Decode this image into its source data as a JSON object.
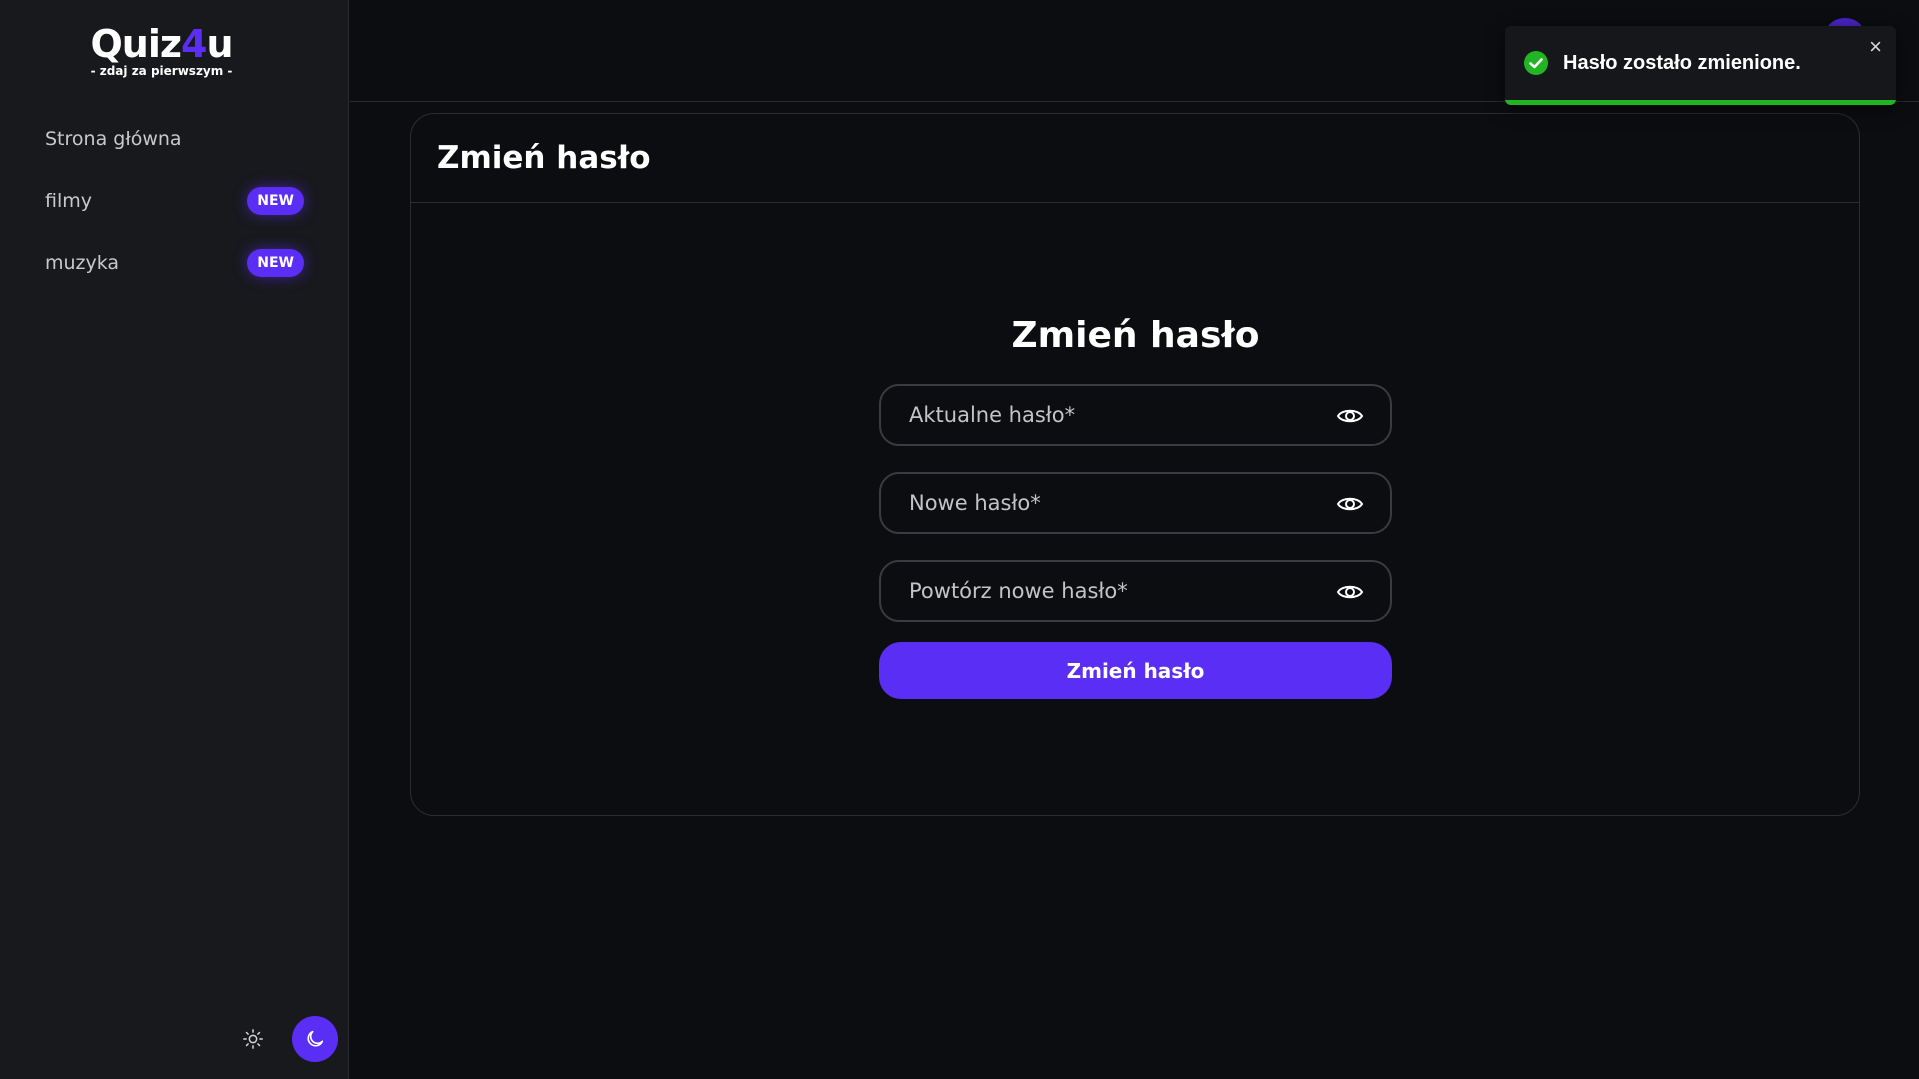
{
  "logo": {
    "title_pre": "Quiz",
    "title_accent": "4",
    "title_post": "u",
    "tagline": "- zdaj za pierwszym -"
  },
  "sidebar": {
    "items": [
      {
        "label": "Strona główna",
        "badge": ""
      },
      {
        "label": "filmy",
        "badge": "NEW"
      },
      {
        "label": "muzyka",
        "badge": "NEW"
      }
    ],
    "theme": {
      "light_icon": "sun-icon",
      "dark_icon": "moon-icon",
      "active": "dark"
    }
  },
  "card": {
    "title": "Zmień hasło"
  },
  "form": {
    "title": "Zmień hasło",
    "current_placeholder": "Aktualne hasło*",
    "new_placeholder": "Nowe hasło*",
    "repeat_placeholder": "Powtórz nowe hasło*",
    "submit_label": "Zmień hasło"
  },
  "toast": {
    "message": "Hasło zostało zmienione.",
    "close_label": "×",
    "icon": "check-circle-icon",
    "progress": 1.0
  },
  "colors": {
    "accent": "#5b2ef5",
    "success": "#22b523",
    "sidebar_bg": "#18191d",
    "page_bg": "#0c0d10"
  }
}
